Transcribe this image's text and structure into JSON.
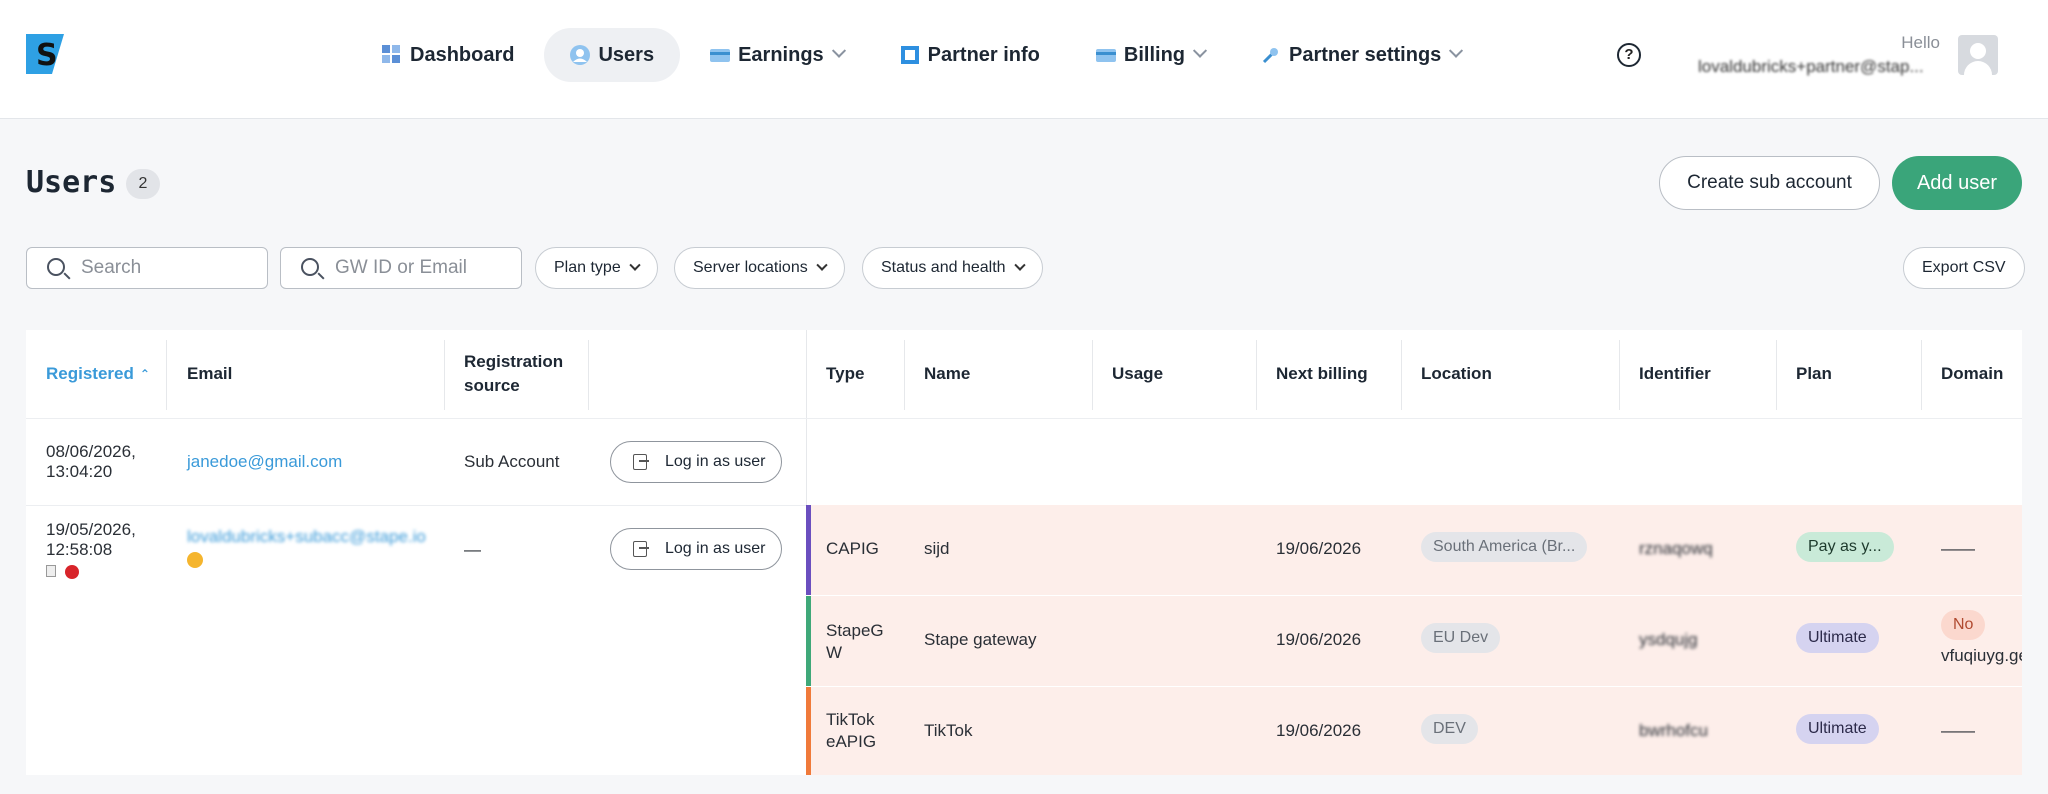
{
  "header": {
    "nav": [
      {
        "label": "Dashboard",
        "icon": "dashboard-icon",
        "active": false,
        "dropdown": false
      },
      {
        "label": "Users",
        "icon": "user-icon",
        "active": true,
        "dropdown": false
      },
      {
        "label": "Earnings",
        "icon": "card-icon",
        "active": false,
        "dropdown": true
      },
      {
        "label": "Partner info",
        "icon": "square-icon",
        "active": false,
        "dropdown": false
      },
      {
        "label": "Billing",
        "icon": "card-icon",
        "active": false,
        "dropdown": true
      },
      {
        "label": "Partner settings",
        "icon": "wrench-icon",
        "active": false,
        "dropdown": true
      }
    ],
    "help_label": "?",
    "hello": "Hello",
    "user_email": "lovaldubricks+partner@stap..."
  },
  "page": {
    "title": "Users",
    "count": "2",
    "create_sub_account": "Create sub account",
    "add_user": "Add user",
    "export_csv": "Export CSV"
  },
  "filters": {
    "search_placeholder": "Search",
    "gw_placeholder": "GW ID or Email",
    "plan_type": "Plan type",
    "server_locations": "Server locations",
    "status_health": "Status and health"
  },
  "table": {
    "left_headers": {
      "registered": "Registered",
      "email": "Email",
      "registration_source_1": "Registration",
      "registration_source_2": "source"
    },
    "right_headers": {
      "type": "Type",
      "name": "Name",
      "usage": "Usage",
      "next_billing": "Next billing",
      "location": "Location",
      "identifier": "Identifier",
      "plan": "Plan",
      "domain": "Domain"
    },
    "users": [
      {
        "registered_date": "08/06/2026,",
        "registered_time": "13:04:20",
        "email": "janedoe@gmail.com",
        "source": "Sub Account",
        "login": "Log in as user"
      },
      {
        "registered_date": "19/05/2026,",
        "registered_time": "12:58:08",
        "email": "lovaldubricks+subacc@stape.io",
        "source": "—",
        "login": "Log in as user"
      }
    ],
    "services": [
      {
        "type_1": "CAPIG",
        "type_2": "",
        "name": "sijd",
        "usage": "",
        "next_billing": "19/06/2026",
        "location": "South America (Br...",
        "identifier": "rznaqowq",
        "plan": "Pay as y...",
        "domain": "——",
        "color": "#6b4fbf"
      },
      {
        "type_1": "StapeG",
        "type_2": "W",
        "name": "Stape gateway",
        "usage": "",
        "next_billing": "19/06/2026",
        "location": "EU Dev",
        "identifier": "ysdqujg",
        "plan": "Ultimate",
        "domain_badge": "No",
        "domain": "vfuqiuyg.ge",
        "color": "#3fa879"
      },
      {
        "type_1": "TikTok",
        "type_2": "eAPIG",
        "name": "TikTok",
        "usage": "",
        "next_billing": "19/06/2026",
        "location": "DEV",
        "identifier": "bwrhofcu",
        "plan": "Ultimate",
        "domain": "——",
        "color": "#f07a3a"
      }
    ]
  }
}
